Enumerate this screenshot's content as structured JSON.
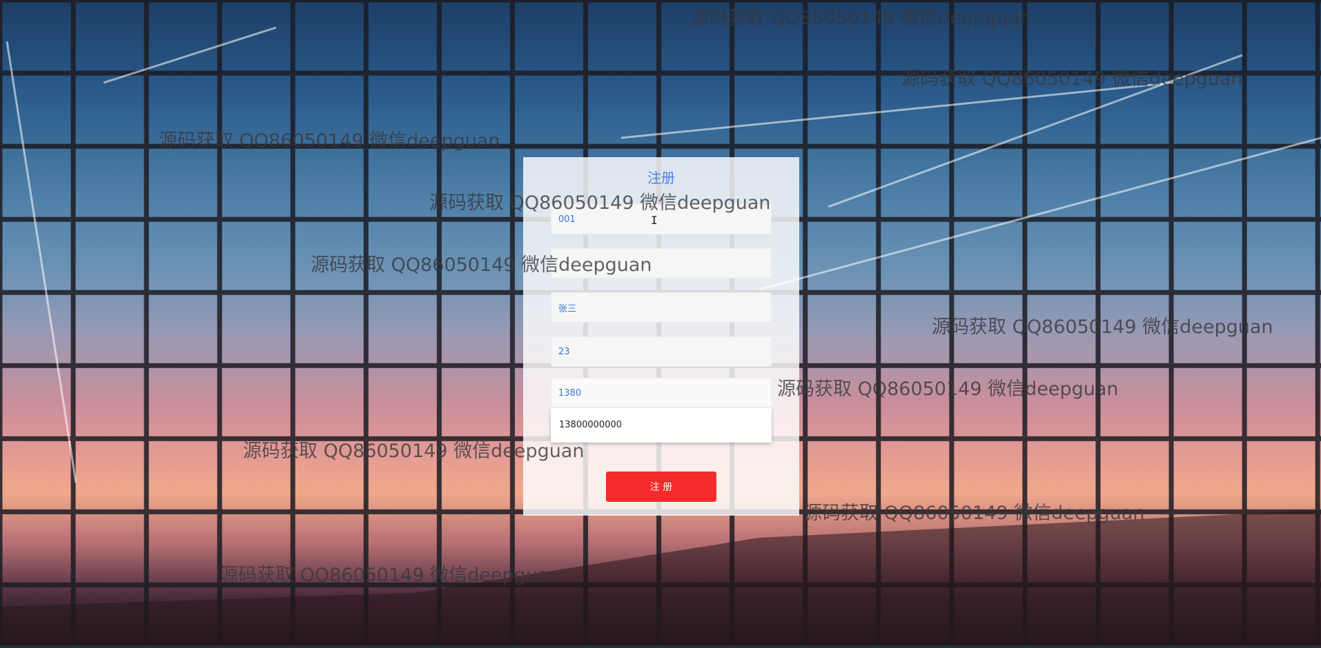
{
  "panel": {
    "title": "注册",
    "fields": [
      {
        "name": "account-field",
        "value": "001",
        "placeholder": ""
      },
      {
        "name": "password-field",
        "value": "",
        "placeholder": ""
      },
      {
        "name": "name-field",
        "value": "张三",
        "placeholder": ""
      },
      {
        "name": "age-field",
        "value": "23",
        "placeholder": ""
      },
      {
        "name": "phone-field",
        "value": "1380",
        "placeholder": ""
      }
    ],
    "autocomplete_suggestion": "13800000000",
    "submit_label": "注 册"
  },
  "watermark_text": "源码获取 QQ86050149 微信deepguan",
  "colors": {
    "title": "#4f7fe6",
    "input_text": "#3a73d6",
    "button": "#f52a2a",
    "button_text": "#ffffff"
  }
}
